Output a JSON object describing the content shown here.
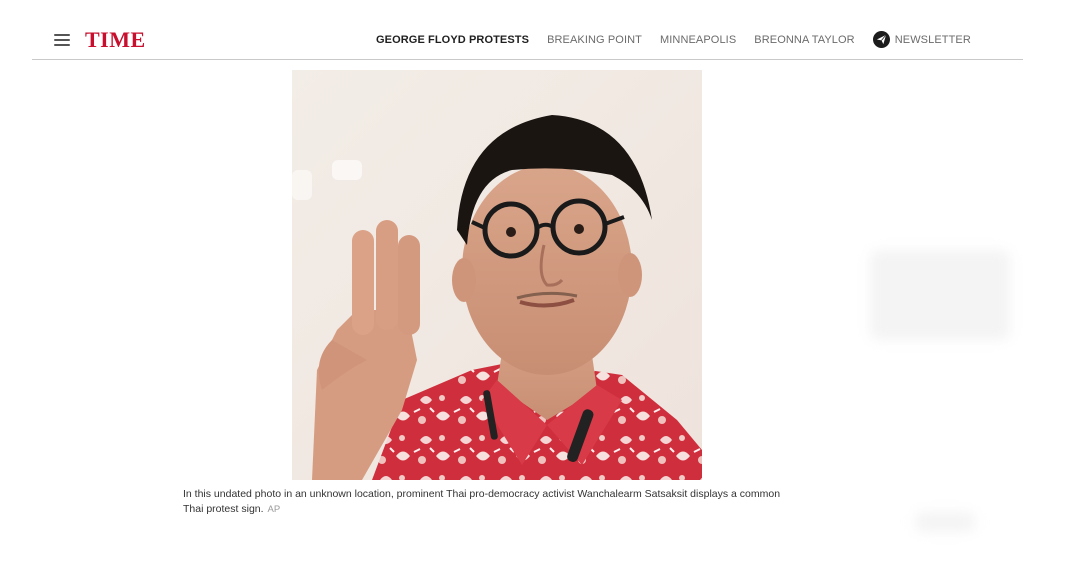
{
  "header": {
    "logo": "TIME",
    "nav": [
      {
        "label": "GEORGE FLOYD PROTESTS",
        "active": true
      },
      {
        "label": "BREAKING POINT",
        "active": false
      },
      {
        "label": "MINNEAPOLIS",
        "active": false
      },
      {
        "label": "BREONNA TAYLOR",
        "active": false
      }
    ],
    "newsletter_label": "NEWSLETTER"
  },
  "article": {
    "caption": "In this undated photo in an unknown location, prominent Thai pro-democracy activist Wanchalearm Satsaksit displays a common Thai protest sign.",
    "credit": "AP"
  },
  "colors": {
    "brand": "#c8102e",
    "nav_active": "#1f1f1f",
    "nav_inactive": "#6b6b6b"
  }
}
